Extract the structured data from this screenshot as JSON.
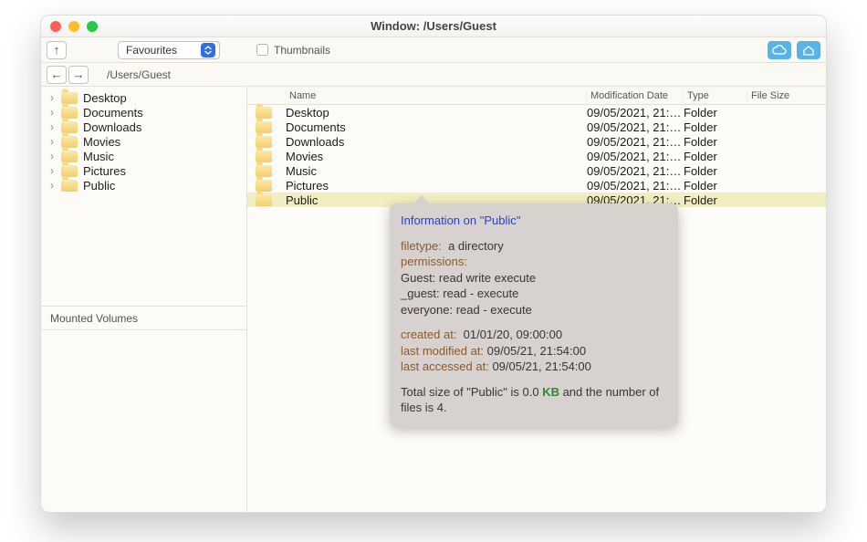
{
  "window": {
    "title": "Window: /Users/Guest"
  },
  "toolbar": {
    "up_glyph": "↑",
    "favourites_label": "Favourites",
    "thumbnails_label": "Thumbnails"
  },
  "pathbar": {
    "back_glyph": "←",
    "forward_glyph": "→",
    "path": "/Users/Guest"
  },
  "sidebar": {
    "items": [
      {
        "label": "Desktop"
      },
      {
        "label": "Documents"
      },
      {
        "label": "Downloads"
      },
      {
        "label": "Movies"
      },
      {
        "label": "Music"
      },
      {
        "label": "Pictures"
      },
      {
        "label": "Public"
      }
    ],
    "mounted_label": "Mounted Volumes"
  },
  "columns": {
    "name": "Name",
    "modification": "Modification Date",
    "type": "Type",
    "filesize": "File Size"
  },
  "rows": [
    {
      "name": "Desktop",
      "date": "09/05/2021, 21:…",
      "type": "Folder",
      "size": "",
      "selected": false
    },
    {
      "name": "Documents",
      "date": "09/05/2021, 21:…",
      "type": "Folder",
      "size": "",
      "selected": false
    },
    {
      "name": "Downloads",
      "date": "09/05/2021, 21:…",
      "type": "Folder",
      "size": "",
      "selected": false
    },
    {
      "name": "Movies",
      "date": "09/05/2021, 21:…",
      "type": "Folder",
      "size": "",
      "selected": false
    },
    {
      "name": "Music",
      "date": "09/05/2021, 21:…",
      "type": "Folder",
      "size": "",
      "selected": false
    },
    {
      "name": "Pictures",
      "date": "09/05/2021, 21:…",
      "type": "Folder",
      "size": "",
      "selected": false
    },
    {
      "name": "Public",
      "date": "09/05/2021, 21:…",
      "type": "Folder",
      "size": "",
      "selected": true
    }
  ],
  "tooltip": {
    "title": "Information on \"Public\"",
    "filetype_label": "filetype:",
    "filetype_value": "a directory",
    "permissions_label": "permissions:",
    "perm_guest": " Guest:  read write execute",
    "perm_uguest": " _guest:  read - execute",
    "perm_every": " everyone:  read - execute",
    "created_label": "created at:",
    "created_value": "01/01/20, 09:00:00",
    "modified_label": "last modified at:",
    "modified_value": "09/05/21, 21:54:00",
    "accessed_label": "last accessed at:",
    "accessed_value": "09/05/21, 21:54:00",
    "size_prefix": "Total size of \"Public\" is 0.0 ",
    "size_unit": "KB",
    "size_suffix": " and the number of files is 4."
  }
}
